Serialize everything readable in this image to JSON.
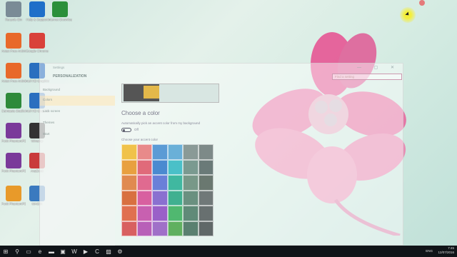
{
  "desktop_icons": [
    {
      "label": "Recycle Bin",
      "color": "#7a8b96"
    },
    {
      "label": "Help & Support",
      "color": "#1e6fc9"
    },
    {
      "label": "Internet Download Manager",
      "color": "#2b8f3a"
    },
    {
      "label": "Avast Free Antivirus",
      "color": "#e8692a"
    },
    {
      "label": "Google Chrome",
      "color": "#d9413a"
    },
    {
      "label": "Avast Free Antivirus",
      "color": "#e8692a"
    },
    {
      "label": "Intel HD Graphics",
      "color": "#2a6fbf"
    },
    {
      "label": "Camtasia Studio 8",
      "color": "#2e8a3a"
    },
    {
      "label": "Intel HD Graphics Control",
      "color": "#2a6fbf"
    },
    {
      "label": "Foxit PhantomPDF",
      "color": "#7a3a9a"
    },
    {
      "label": "Winamp",
      "color": "#333"
    },
    {
      "label": "Foxit PhantomPDF",
      "color": "#7a3a9a"
    },
    {
      "label": "AnyDesk",
      "color": "#c93b3b"
    },
    {
      "label": "Foxit PhantomPDF",
      "color": "#e89a2a"
    },
    {
      "label": "MAGIX",
      "color": "#3a7abf"
    }
  ],
  "window": {
    "title": "Settings",
    "controls": "— ▢ ✕",
    "header": "PERSONALIZATION",
    "search_placeholder": "Find a setting",
    "sidebar": [
      {
        "label": "Background",
        "active": false
      },
      {
        "label": "Colors",
        "active": true
      },
      {
        "label": "Lock screen",
        "active": false
      },
      {
        "label": "Themes",
        "active": false
      },
      {
        "label": "Start",
        "active": false
      }
    ],
    "content": {
      "heading": "Choose a color",
      "auto_label": "Automatically pick an accent color from my background",
      "toggle_state": "Off",
      "accent_label": "Choose your accent color",
      "swatches": [
        "#f0c24a",
        "#e88a8a",
        "#5b9bd5",
        "#6ab0d8",
        "#8a9a97",
        "#7d8a88",
        "#e8a040",
        "#e06a7a",
        "#4a8ad0",
        "#4ac0c8",
        "#7a9a90",
        "#6a7a78",
        "#e08a50",
        "#e06a90",
        "#6a80d8",
        "#40b8a0",
        "#789888",
        "#6a7870",
        "#d87040",
        "#d860a0",
        "#8a70d0",
        "#40b090",
        "#6a9080",
        "#707878",
        "#e07050",
        "#c860b0",
        "#9a60c8",
        "#50b870",
        "#608a78",
        "#687070",
        "#d86060",
        "#b860b8",
        "#a070c8",
        "#60b060",
        "#5a8070",
        "#606868"
      ]
    }
  },
  "taskbar": {
    "icons": [
      {
        "name": "start-icon",
        "glyph": "⊞"
      },
      {
        "name": "search-icon",
        "glyph": "⚲"
      },
      {
        "name": "task-view-icon",
        "glyph": "▭"
      },
      {
        "name": "edge-icon",
        "glyph": "e"
      },
      {
        "name": "file-explorer-icon",
        "glyph": "▬"
      },
      {
        "name": "store-icon",
        "glyph": "▣"
      },
      {
        "name": "word-icon",
        "glyph": "W"
      },
      {
        "name": "media-icon",
        "glyph": "▶"
      },
      {
        "name": "camtasia-icon",
        "glyph": "C"
      },
      {
        "name": "photos-icon",
        "glyph": "▨"
      },
      {
        "name": "settings-icon",
        "glyph": "⚙"
      }
    ],
    "language": "ENG",
    "time": "7:45",
    "date": "12/07/2016"
  }
}
